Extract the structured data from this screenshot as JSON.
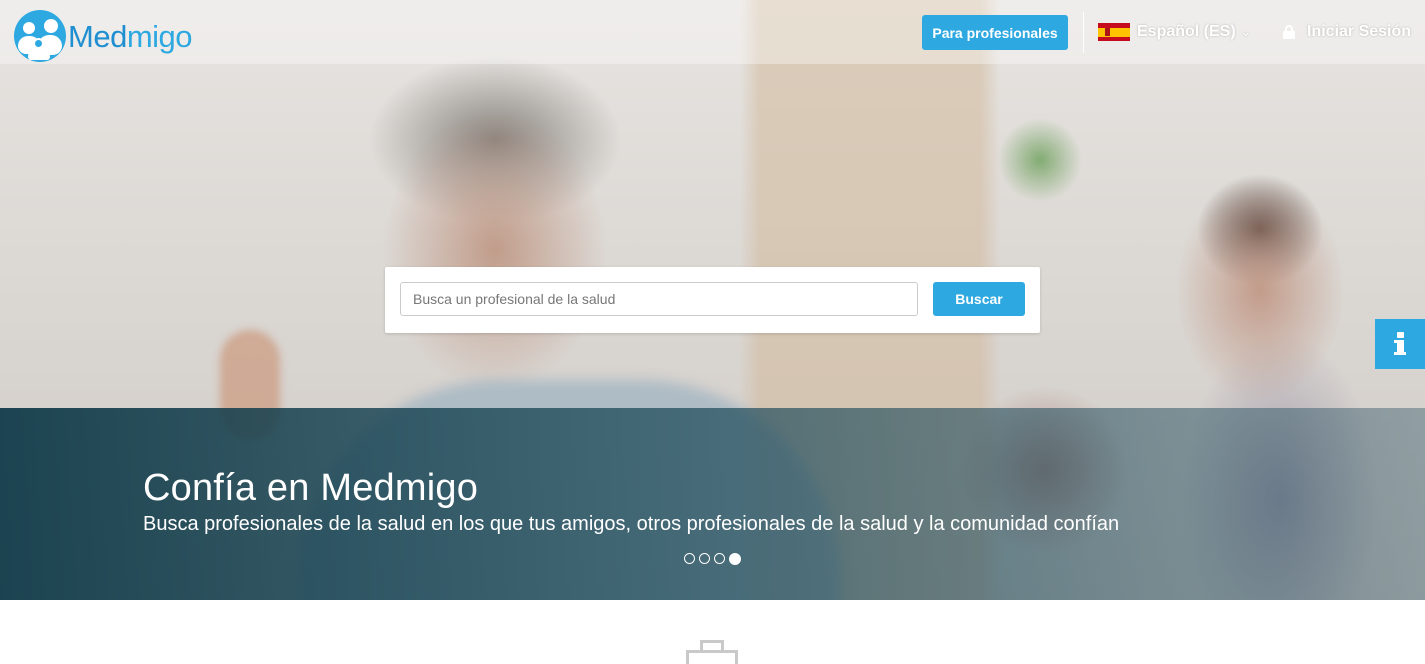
{
  "brand": {
    "logo_text_part1": "Med",
    "logo_text_part2": "migo"
  },
  "nav": {
    "professionals_button": "Para profesionales",
    "language_label": "Español (ES)",
    "language_flag": "spain-flag-icon",
    "login_label": "Iniciar Sesión"
  },
  "search": {
    "placeholder": "Busca un profesional de la salud",
    "value": "",
    "button_label": "Buscar"
  },
  "carousel": {
    "title": "Confía en Medmigo",
    "subtitle": "Busca profesionales de la salud en los que tus amigos, otros profesionales de la salud y la comunidad confían",
    "slide_count": 4,
    "active_slide": 4
  },
  "colors": {
    "accent": "#2ea8e0",
    "caption_band": "#0c3746",
    "white": "#ffffff"
  }
}
